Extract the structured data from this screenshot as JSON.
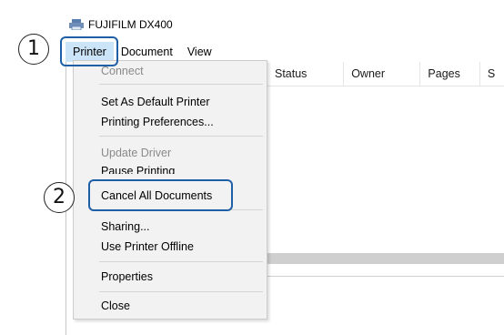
{
  "window": {
    "title": "FUJIFILM DX400"
  },
  "menubar": {
    "items": [
      "Printer",
      "Document",
      "View"
    ]
  },
  "columns": [
    "Status",
    "Owner",
    "Pages",
    "S"
  ],
  "dropdown": {
    "items": [
      {
        "label": "Connect",
        "enabled": false
      },
      {
        "label": "Set As Default Printer",
        "enabled": true
      },
      {
        "label": "Printing Preferences...",
        "enabled": true
      },
      {
        "label": "Update Driver",
        "enabled": false
      },
      {
        "label": "Pause Printing",
        "enabled": true
      },
      {
        "label": "Cancel All Documents",
        "enabled": true
      },
      {
        "label": "Sharing...",
        "enabled": true
      },
      {
        "label": "Use Printer Offline",
        "enabled": true
      },
      {
        "label": "Properties",
        "enabled": true
      },
      {
        "label": "Close",
        "enabled": true
      }
    ]
  },
  "callouts": {
    "step1": "1",
    "step2": "2"
  },
  "colors": {
    "highlight": "#1f5fa8",
    "menu_active": "#cce4f7"
  }
}
